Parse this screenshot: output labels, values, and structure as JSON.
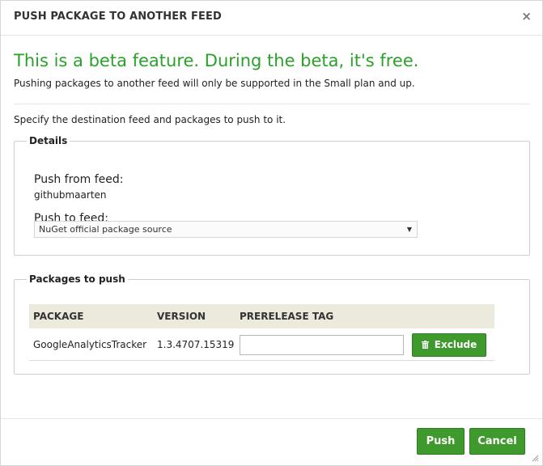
{
  "dialog": {
    "title": "PUSH PACKAGE TO ANOTHER FEED",
    "close_symbol": "×"
  },
  "beta": {
    "headline": "This is a beta feature. During the beta, it's free.",
    "subtext": "Pushing packages to another feed will only be supported in the Small plan and up."
  },
  "instructions": "Specify the destination feed and packages to push to it.",
  "details": {
    "legend": "Details",
    "push_from_label": "Push from feed:",
    "push_from_value": "githubmaarten",
    "push_to_label": "Push to feed:",
    "push_to_selected": "NuGet official package source",
    "caret_symbol": "▼"
  },
  "packages": {
    "legend": "Packages to push",
    "columns": [
      "PACKAGE",
      "VERSION",
      "PRERELEASE TAG"
    ],
    "rows": [
      {
        "package": "GoogleAnalyticsTracker",
        "version": "1.3.4707.15319",
        "prerelease_tag": "",
        "action_label": "Exclude"
      }
    ]
  },
  "footer": {
    "push_label": "Push",
    "cancel_label": "Cancel"
  },
  "colors": {
    "accent_green": "#3e9a2c",
    "beta_text_green": "#2aa12a",
    "table_header_bg": "#ece9dd"
  },
  "icons": [
    "close-icon",
    "dropdown-caret-icon",
    "trash-icon",
    "resize-grip-icon"
  ]
}
